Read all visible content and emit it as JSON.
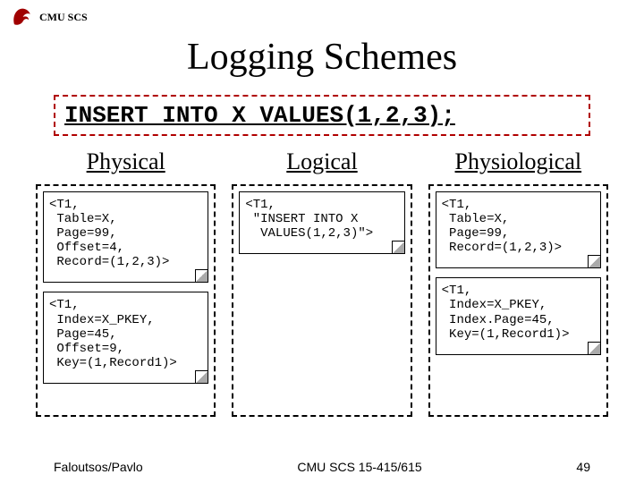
{
  "header": {
    "label": "CMU SCS"
  },
  "title": "Logging Schemes",
  "sql": "INSERT INTO X VALUES(1,2,3);",
  "cols": {
    "physical": {
      "title": "Physical",
      "note1": "<T1,\n Table=X,\n Page=99,\n Offset=4,\n Record=(1,2,3)>",
      "note2": "<T1,\n Index=X_PKEY,\n Page=45,\n Offset=9,\n Key=(1,Record1)>"
    },
    "logical": {
      "title": "Logical",
      "note1": "<T1,\n \"INSERT INTO X\n  VALUES(1,2,3)\">"
    },
    "physiological": {
      "title": "Physiological",
      "note1": "<T1,\n Table=X,\n Page=99,\n Record=(1,2,3)>",
      "note2": "<T1,\n Index=X_PKEY,\n Index.Page=45,\n Key=(1,Record1)>"
    }
  },
  "footer": {
    "left": "Faloutsos/Pavlo",
    "center": "CMU SCS 15-415/615",
    "right": "49"
  }
}
